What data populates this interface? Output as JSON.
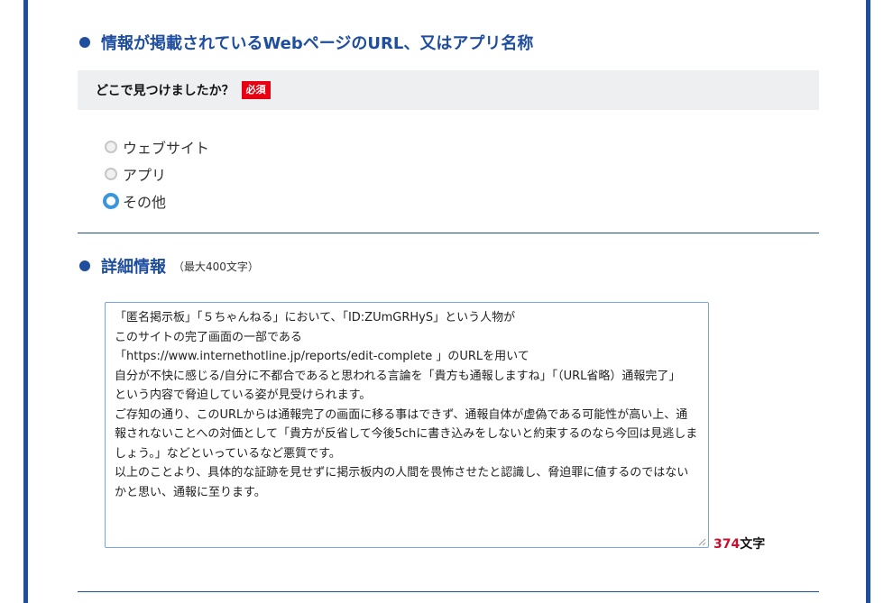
{
  "section_source": {
    "heading": "情報が掲載されているWebページのURL、又はアプリ名称",
    "question": "どこで見つけましたか？",
    "required_badge": "必須",
    "options": [
      {
        "label": "ウェブサイト",
        "checked": false
      },
      {
        "label": "アプリ",
        "checked": false
      },
      {
        "label": "その他",
        "checked": true
      }
    ]
  },
  "section_detail": {
    "heading": "詳細情報",
    "note": "（最大400文字）",
    "textarea_value": "「匿名掲示板」「５ちゃんねる」において、「ID:ZUmGRHyS」という人物が\nこのサイトの完了画面の一部である\n「https://www.internethotline.jp/reports/edit-complete 」のURLを用いて\n自分が不快に感じる/自分に不都合であると思われる言論を「貴方も通報しますね」「（URL省略）通報完了」\nという内容で脅迫している姿が見受けられます。\nご存知の通り、このURLからは通報完了の画面に移る事はできず、通報自体が虚偽である可能性が高い上、通報されないことへの対価として「貴方が反省して今後5chに書き込みをしないと約束するのなら今回は見逃しましょう。」などといっているなど悪質です。\n以上のことより、具体的な証跡を見せずに掲示板内の人間を畏怖させたと認識し、脅迫罪に値するのではないかと思い、通報に至ります。",
    "char_count": "374",
    "char_unit": "文字"
  },
  "colors": {
    "brand_blue": "#1f4e9e",
    "required_red": "#e60012",
    "radio_checked": "#3a95db",
    "counter_red": "#c8102e"
  }
}
